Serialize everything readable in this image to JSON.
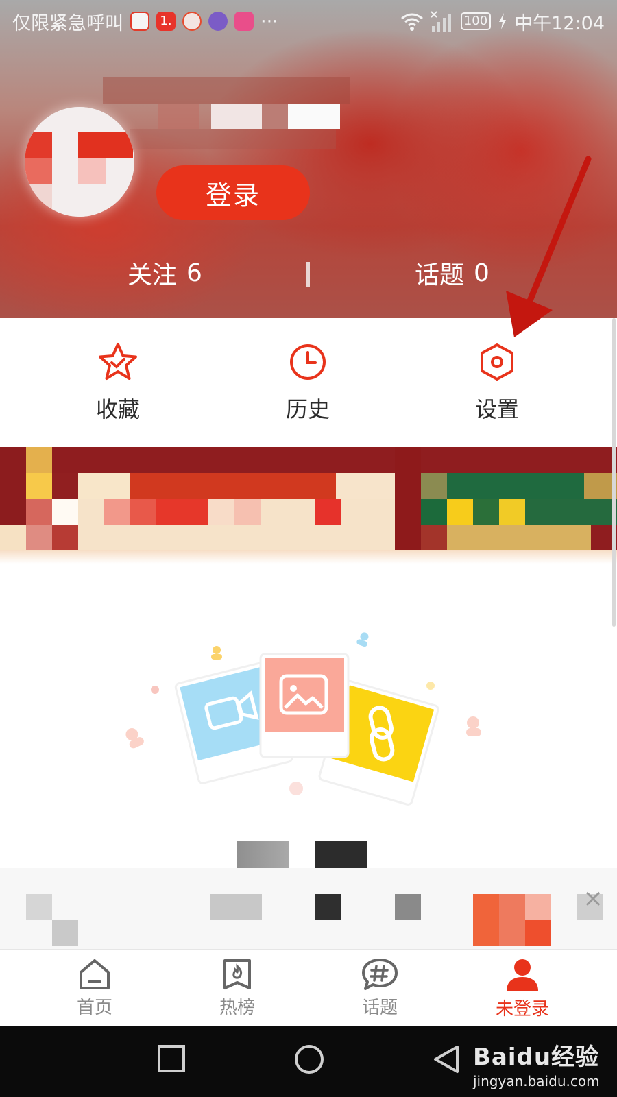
{
  "status_bar": {
    "carrier_text": "仅限紧急呼叫",
    "more_indicator": "···",
    "battery_level": "100",
    "time": "中午12:04",
    "icons": [
      "sina-app-icon",
      "one-app-icon",
      "news-app-icon",
      "browser-app-icon",
      "music-app-icon",
      "wifi-icon",
      "signal-off-icon",
      "battery-icon",
      "charging-icon"
    ]
  },
  "profile": {
    "login_label": "登录",
    "stats": [
      {
        "label": "关注",
        "value": "6"
      },
      {
        "label": "话题",
        "value": "0"
      }
    ]
  },
  "actions": [
    {
      "label": "收藏",
      "icon": "star-check-icon"
    },
    {
      "label": "历史",
      "icon": "clock-icon"
    },
    {
      "label": "设置",
      "icon": "hexagon-gear-icon"
    }
  ],
  "annotation": {
    "arrow_target": "设置",
    "arrow_color": "#c4170f"
  },
  "bottom_nav": {
    "items": [
      {
        "label": "首页",
        "icon": "home-icon",
        "active": false
      },
      {
        "label": "热榜",
        "icon": "hot-list-icon",
        "active": false
      },
      {
        "label": "话题",
        "icon": "topic-hash-icon",
        "active": false
      },
      {
        "label": "未登录",
        "icon": "user-icon",
        "active": true
      }
    ]
  },
  "colors": {
    "accent": "#e8331b",
    "inactive": "#8a8a8a",
    "active_tab": "#e8331b"
  },
  "watermark": {
    "main": "Baidu经验",
    "sub": "jingyan.baidu.com"
  }
}
